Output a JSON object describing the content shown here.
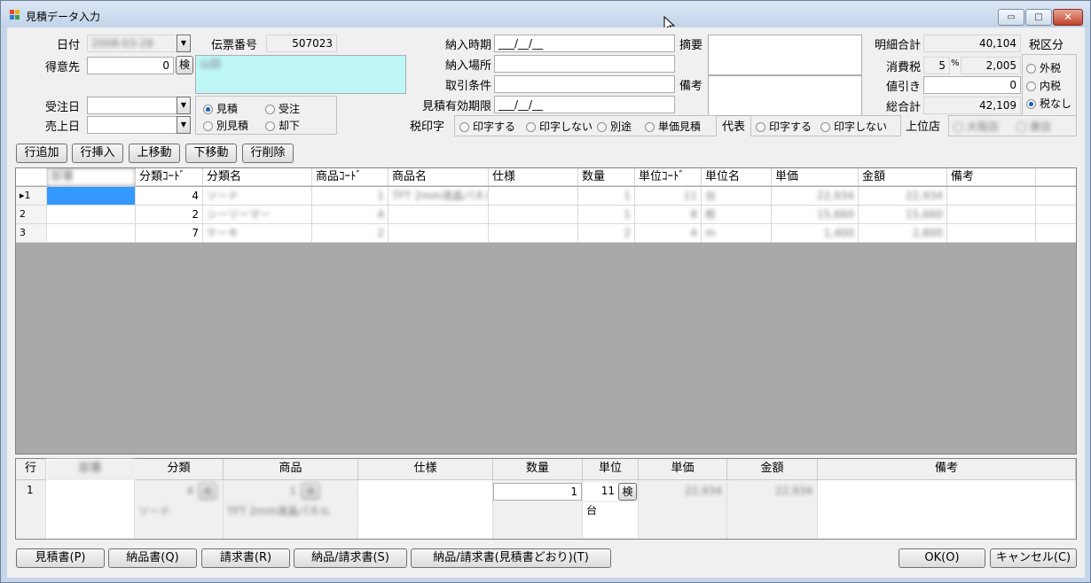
{
  "window": {
    "title": "見積データ入力",
    "min_label": "▭",
    "max_label": "□",
    "close_label": "✕"
  },
  "colors": {
    "accent": "#3399ff",
    "customer_name_bg": "#bff7f7",
    "grid_bg": "#a9a9a9"
  },
  "form": {
    "date_label": "日付",
    "date_value": "2008-03-28",
    "slip_label": "伝票番号",
    "slip_value": "507023",
    "customer_label": "得意先",
    "customer_code": "0",
    "search_label": "検",
    "customer_name": "山田",
    "order_date_label": "受注日",
    "sales_date_label": "売上日",
    "status": {
      "estimate": "見積",
      "order": "受注",
      "alt_estimate": "別見積",
      "rejected": "却下"
    },
    "delivery_time_label": "納入時期",
    "delivery_time_value": "___/__/__",
    "delivery_place_label": "納入場所",
    "terms_label": "取引条件",
    "validity_label": "見積有効期限",
    "validity_value": "___/__/__",
    "summary_label": "摘要",
    "remarks_label": "備考",
    "subtotal_label": "明細合計",
    "subtotal_value": "40,104",
    "tax_label": "消費税",
    "tax_rate": "5",
    "tax_percent": "%",
    "tax_value": "2,005",
    "discount_label": "値引き",
    "discount_value": "0",
    "total_label": "総合計",
    "total_value": "42,109",
    "tax_class_label": "税区分",
    "tax_exclusive": "外税",
    "tax_inclusive": "内税",
    "tax_none": "税なし",
    "tax_print_label": "税印字",
    "print_yes": "印字する",
    "print_no": "印字しない",
    "separate": "別途",
    "unit_estimate": "単価見積",
    "rep_label": "代表",
    "rep_print_yes": "印字する",
    "rep_print_no": "印字しない",
    "parent_label": "上位店",
    "parent_opt1": "大阪店",
    "parent_opt2": "東店"
  },
  "row_buttons": {
    "add": "行追加",
    "insert": "行挿入",
    "up": "上移動",
    "down": "下移動",
    "delete": "行削除"
  },
  "grid": {
    "columns": [
      "部署",
      "分類ｺｰﾄﾞ",
      "分類名",
      "商品ｺｰﾄﾞ",
      "商品名",
      "仕様",
      "数量",
      "単位ｺｰﾄﾞ",
      "単位名",
      "単価",
      "金額",
      "備考"
    ],
    "rows": [
      {
        "marker": "▸1",
        "c0": "",
        "c1": "4",
        "c2": "ソード",
        "c3": "1",
        "c4": "TFT 2mm液晶パネル",
        "c5": "",
        "c6": "1",
        "c7": "11",
        "c8": "台",
        "c9": "22,934",
        "c10": "22,934",
        "c11": ""
      },
      {
        "marker": "2",
        "c0": "",
        "c1": "2",
        "c2": "シーリーマー",
        "c3": "4",
        "c4": "",
        "c5": "",
        "c6": "1",
        "c7": "8",
        "c8": "枚",
        "c9": "15,660",
        "c10": "15,660",
        "c11": ""
      },
      {
        "marker": "3",
        "c0": "",
        "c1": "7",
        "c2": "ケーキ",
        "c3": "2",
        "c4": "",
        "c5": "",
        "c6": "2",
        "c7": "4",
        "c8": "m",
        "c9": "1,400",
        "c10": "2,800",
        "c11": ""
      }
    ]
  },
  "detail": {
    "columns": [
      "行",
      "部署",
      "分類",
      "商品",
      "仕様",
      "数量",
      "単位",
      "単価",
      "金額",
      "備考"
    ],
    "row_no": "1",
    "category_code": "4",
    "category_name": "ソード",
    "product_code": "1",
    "product_name": "TFT 2mm液晶パネル",
    "search_label": "検",
    "qty": "1",
    "unit_code": "11",
    "unit_name": "台",
    "price": "22,934",
    "amount": "22,934"
  },
  "bottom_buttons": {
    "estimate": "見積書(P)",
    "delivery": "納品書(Q)",
    "invoice": "請求書(R)",
    "delivery_invoice": "納品/請求書(S)",
    "delivery_invoice_est": "納品/請求書(見積書どおり)(T)",
    "ok": "OK(O)",
    "cancel": "キャンセル(C)"
  }
}
